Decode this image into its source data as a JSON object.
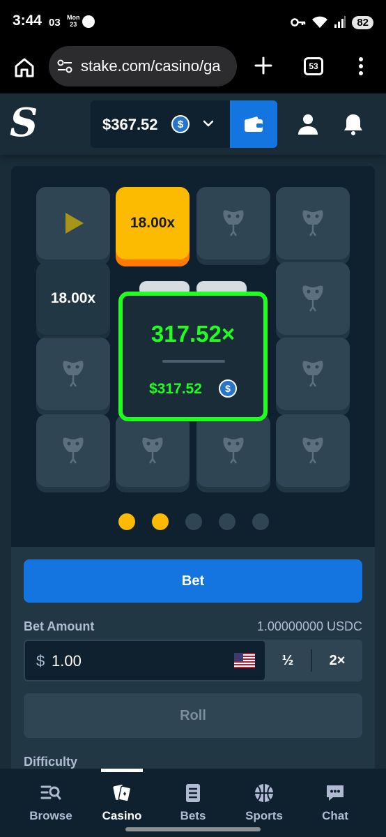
{
  "status_bar": {
    "time": "3:44",
    "date": "03",
    "day_top": "Mon",
    "day_bottom": "23",
    "battery": "82"
  },
  "browser": {
    "url": "stake.com/casino/ga",
    "tab_count": "53"
  },
  "header": {
    "logo": "S",
    "balance": "$367.52",
    "currency_icon": "usdc-coin-icon"
  },
  "game": {
    "tiles": {
      "start": "play-icon",
      "gold_multiplier": "18.00x",
      "revealed_multiplier": "18.00x",
      "hidden": "snake-icon"
    },
    "win": {
      "multiplier": "317.52×",
      "amount": "$317.52"
    },
    "dots": [
      "active",
      "active",
      "inactive",
      "inactive",
      "inactive"
    ]
  },
  "controls": {
    "bet_button": "Bet",
    "bet_amount_label": "Bet Amount",
    "bet_amount_crypto": "1.00000000 USDC",
    "bet_currency_symbol": "$",
    "bet_value": "1.00",
    "half_label": "½",
    "double_label": "2×",
    "roll_button": "Roll",
    "difficulty_label": "Difficulty"
  },
  "nav": {
    "items": [
      {
        "label": "Browse",
        "icon": "browse-icon"
      },
      {
        "label": "Casino",
        "icon": "casino-icon",
        "active": true
      },
      {
        "label": "Bets",
        "icon": "bets-icon"
      },
      {
        "label": "Sports",
        "icon": "sports-icon"
      },
      {
        "label": "Chat",
        "icon": "chat-icon"
      }
    ]
  },
  "colors": {
    "background": "#1a2c38",
    "accent_blue": "#1475e1",
    "win_green": "#1fff20",
    "gold": "#fcbb00"
  }
}
